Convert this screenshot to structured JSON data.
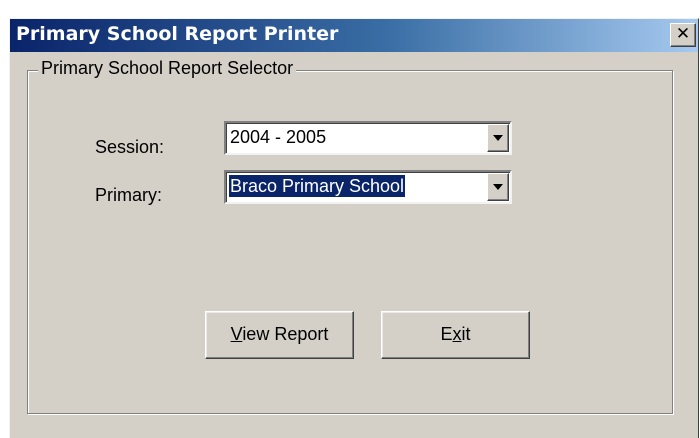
{
  "window": {
    "title": "Primary School Report Printer",
    "close_label": "✕",
    "close_icon": "close-icon"
  },
  "group": {
    "legend": "Primary School Report Selector"
  },
  "session": {
    "label": "Session:",
    "value": "2004 - 2005",
    "dropdown_icon": "chevron-down-icon"
  },
  "primary": {
    "label": "Primary:",
    "value": "Braco Primary School",
    "selected": true,
    "dropdown_icon": "chevron-down-icon"
  },
  "buttons": {
    "view_report": {
      "mnemonic": "V",
      "rest": "iew Report"
    },
    "exit": {
      "pre": "E",
      "mnemonic": "x",
      "rest": "it"
    }
  },
  "colors": {
    "titlebar_start": "#0a246a",
    "titlebar_end": "#a6caf0",
    "face": "#d4d0c8",
    "selection": "#0a246a"
  }
}
